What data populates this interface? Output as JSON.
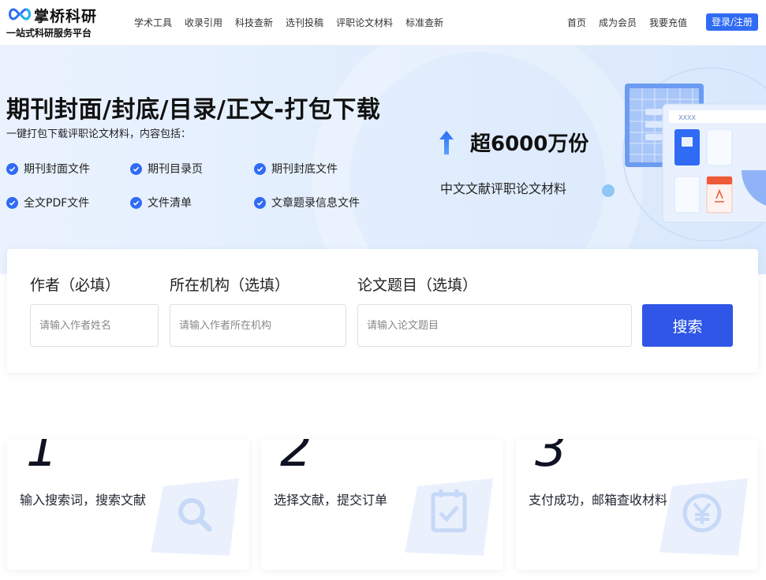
{
  "brand": {
    "name": "掌桥科研",
    "tagline": "一站式科研服务平台"
  },
  "nav": {
    "items": [
      "学术工具",
      "收录引用",
      "科技查新",
      "选刊投稿",
      "评职论文材料",
      "标准查新"
    ],
    "right_items": [
      "首页",
      "成为会员",
      "我要充值"
    ],
    "login_label": "登录/注册"
  },
  "colors": {
    "accent": "#2f6bf4",
    "search_button": "#2f56e6",
    "hero_bg": "#e2eefd"
  },
  "hero": {
    "title": "期刊封面/封底/目录/正文-打包下载",
    "subtitle": "一键打包下载评职论文材料，内容包括：",
    "features": [
      "期刊封面文件",
      "期刊目录页",
      "期刊封底文件",
      "全文PDF文件",
      "文件清单",
      "文章题录信息文件"
    ],
    "stat_value": "超6000万份",
    "stat_desc": "中文文献评职论文材料",
    "illustration_label": "XXXX"
  },
  "search": {
    "fields": [
      {
        "label": "作者（必填）",
        "placeholder": "请输入作者姓名",
        "value": ""
      },
      {
        "label": "所在机构（选填）",
        "placeholder": "请输入作者所在机构",
        "value": ""
      },
      {
        "label": "论文题目（选填）",
        "placeholder": "请输入论文题目",
        "value": ""
      }
    ],
    "button_label": "搜索"
  },
  "steps": [
    {
      "number": "1",
      "text": "输入搜索词，搜索文献",
      "icon": "search-icon"
    },
    {
      "number": "2",
      "text": "选择文献，提交订单",
      "icon": "clipboard-check-icon"
    },
    {
      "number": "3",
      "text": "支付成功，邮箱查收材料",
      "icon": "yen-icon"
    }
  ]
}
